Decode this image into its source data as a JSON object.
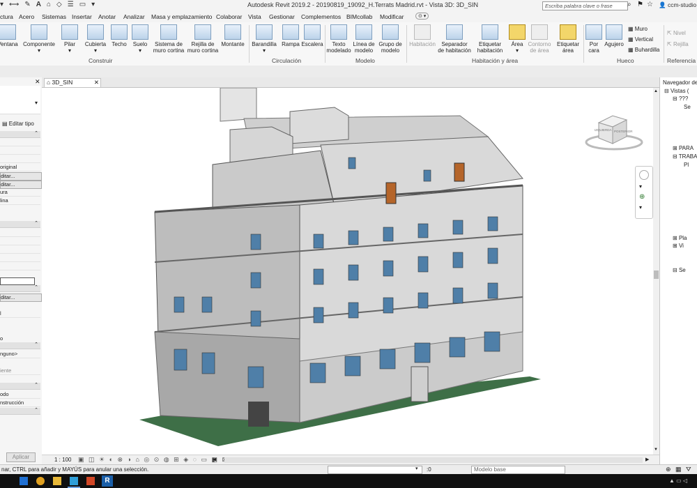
{
  "window": {
    "title": "Autodesk Revit 2019.2 - 20190819_19092_H.Terrats Madrid.rvt - Vista 3D: 3D_SIN",
    "search_placeholder": "Escriba palabra clave o frase",
    "user": "ccm-studio"
  },
  "menu_tabs": [
    "ctura",
    "Acero",
    "Sistemas",
    "Insertar",
    "Anotar",
    "Analizar",
    "Masa y emplazamiento",
    "Colaborar",
    "Vista",
    "Gestionar",
    "Complementos",
    "BIMcollab",
    "Modificar"
  ],
  "ribbon": {
    "buttons": [
      {
        "label": "Ventana",
        "label2": ""
      },
      {
        "label": "Componente",
        "label2": "",
        "dropdown": true
      },
      {
        "label": "Pilar",
        "label2": "",
        "dropdown": true
      },
      {
        "label": "Cubierta",
        "label2": "",
        "dropdown": true
      },
      {
        "label": "Techo",
        "label2": ""
      },
      {
        "label": "Suelo",
        "label2": "",
        "dropdown": true
      },
      {
        "label": "Sistema de",
        "label2": "muro cortina"
      },
      {
        "label": "Rejilla de",
        "label2": "muro cortina"
      },
      {
        "label": "Montante",
        "label2": ""
      },
      {
        "label": "Barandilla",
        "label2": "",
        "dropdown": true
      },
      {
        "label": "Rampa",
        "label2": ""
      },
      {
        "label": "Escalera",
        "label2": ""
      },
      {
        "label": "Texto",
        "label2": "modelado"
      },
      {
        "label": "Línea de",
        "label2": "modelo"
      },
      {
        "label": "Grupo de",
        "label2": "modelo",
        "dropdown": true
      },
      {
        "label": "Habitación",
        "label2": "",
        "disabled": true
      },
      {
        "label": "Separador",
        "label2": "de habitación"
      },
      {
        "label": "Etiquetar",
        "label2": "habitación",
        "dropdown": true
      },
      {
        "label": "Área",
        "label2": "",
        "dropdown": true
      },
      {
        "label": "Contorno",
        "label2": "de área",
        "disabled": true
      },
      {
        "label": "Etiquetar",
        "label2": "área",
        "dropdown": true
      },
      {
        "label": "Por",
        "label2": "cara"
      },
      {
        "label": "Agujero",
        "label2": ""
      }
    ],
    "hueco_small": [
      "Muro",
      "Vertical",
      "Buhardilla"
    ],
    "referencia_small": [
      "Nivel",
      "Rejilla"
    ],
    "panels": [
      "Construir",
      "Circulación",
      "Modelo",
      "Habitación y área",
      "Hueco",
      "Referencia"
    ]
  },
  "properties": {
    "edit_type": "Editar tipo",
    "rows": [
      "original",
      "ditar...",
      "ditar...",
      "ura",
      "lina",
      "ditar...",
      "l",
      "o",
      "nguno>",
      "iente",
      "odo",
      "nstrucción"
    ],
    "apply": "Aplicar"
  },
  "view_tab": {
    "label": "3D_SIN"
  },
  "viewcube": {
    "face_left": "IZQUIERDA",
    "face_right": "POSTERIOR"
  },
  "browser": {
    "title": "Navegador de",
    "items": [
      "Vistas (",
      "???",
      "Se",
      "PARA",
      "TRABA",
      "Pl",
      "Pla",
      "Vi",
      "Se"
    ]
  },
  "view_controls": {
    "scale": "1 : 100"
  },
  "status": {
    "message": "nar, CTRL para añadir y MAYÚS para anular una selección.",
    "selected_count": ":0",
    "model": "Modelo base"
  },
  "colors": {
    "ribbon_bg": "#f7f7f7",
    "facade": "#d9d9d9",
    "facade_dark": "#9e9e9e",
    "roof": "#c8c8c8",
    "ground": "#3e6f47",
    "glass": "#4f7fa8",
    "door_wood": "#b5652a",
    "taskbar": "#101010"
  }
}
